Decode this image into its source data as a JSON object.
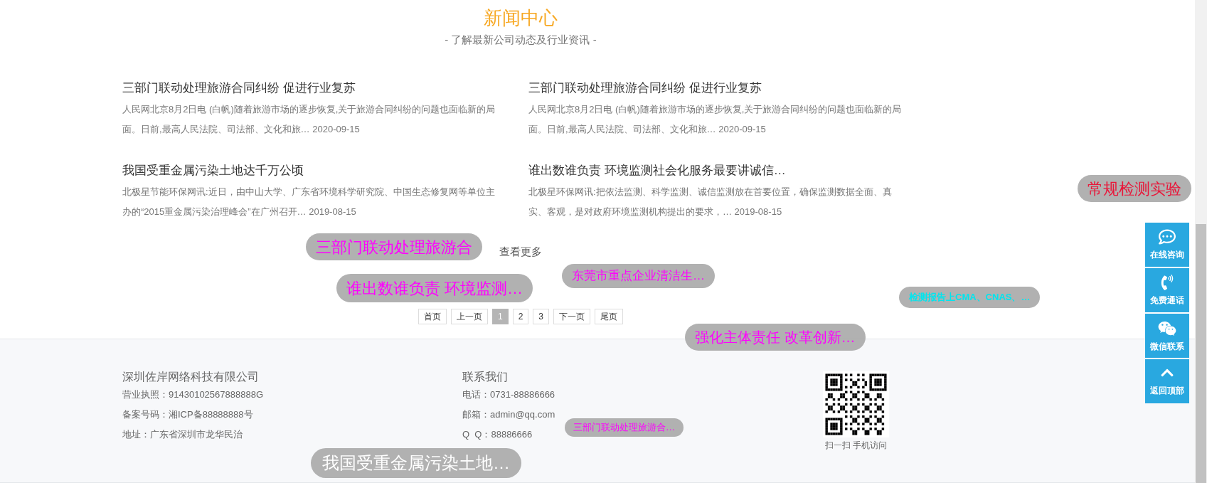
{
  "news_section": {
    "title": "新闻中心",
    "subtitle": "- 了解最新公司动态及行业资讯 -"
  },
  "news": [
    {
      "title": "三部门联动处理旅游合同纠纷 促进行业复苏",
      "summary": "人民网北京8月2日电 (白帆)随着旅游市场的逐步恢复,关于旅游合同纠纷的问题也面临新的局面。日前,最高人民法院、司法部、文化和旅…",
      "date": "2020-09-15"
    },
    {
      "title": "三部门联动处理旅游合同纠纷 促进行业复苏",
      "summary": "人民网北京8月2日电 (白帆)随着旅游市场的逐步恢复,关于旅游合同纠纷的问题也面临新的局面。日前,最高人民法院、司法部、文化和旅…",
      "date": "2020-09-15"
    },
    {
      "title": "我国受重金属污染土地达千万公顷",
      "summary": "北极星节能环保网讯:近日，由中山大学、广东省环境科学研究院、中国生态修复网等单位主办的“2015重金属污染治理峰会”在广州召开…",
      "date": "2019-08-15"
    },
    {
      "title": "谁出数谁负责 环境监测社会化服务最要讲诚信…",
      "summary": "北极星环保网讯:把依法监测、科学监测、诚信监测放在首要位置，确保监测数据全面、真实、客观，是对政府环境监测机构提出的要求，…",
      "date": "2019-08-15"
    }
  ],
  "more_link": "查看更多",
  "pagination": [
    {
      "label": "首页",
      "selected": false
    },
    {
      "label": "上一页",
      "selected": false
    },
    {
      "label": "1",
      "selected": true
    },
    {
      "label": "2",
      "selected": false
    },
    {
      "label": "3",
      "selected": false
    },
    {
      "label": "下一页",
      "selected": false
    },
    {
      "label": "尾页",
      "selected": false
    }
  ],
  "footer": {
    "company": {
      "name": "深圳佐岸网络科技有限公司",
      "lines": [
        "营业执照：91430102567888888G",
        "备案号码：湘ICP备88888888号",
        "地址：广东省深圳市龙华民治"
      ]
    },
    "contact": {
      "title": "联系我们",
      "lines": [
        "电话：0731-88886666",
        "邮箱：admin@qq.com",
        "Q  Q：88886666"
      ]
    },
    "qr": {
      "caption": "扫一扫 手机访问"
    }
  },
  "side_buttons": [
    {
      "kind": "chat",
      "label": "在线咨询"
    },
    {
      "kind": "phone",
      "label": "免费通话"
    },
    {
      "kind": "wechat",
      "label": "微信联系"
    },
    {
      "kind": "top",
      "label": "返回顶部"
    }
  ],
  "danmaku": [
    {
      "text": "常规检测实验",
      "color": "#e8173a"
    },
    {
      "text": "三部门联动处理旅游合",
      "color": "#ff00ff"
    },
    {
      "text": "东莞市重点企业清洁生…",
      "color": "#ff00ff"
    },
    {
      "text": "谁出数谁负责 环境监测…",
      "color": "#ff00ff"
    },
    {
      "text": "检测报告上CMA、CNAS、…",
      "color": "#00e5ee"
    },
    {
      "text": "强化主体责任 改革创新…",
      "color": "#ff00ff"
    },
    {
      "text": "我国受重金属污染土地…",
      "color": "#ffffff"
    },
    {
      "text": "三部门联动处理旅游合…",
      "color": "#ff00ff"
    }
  ]
}
